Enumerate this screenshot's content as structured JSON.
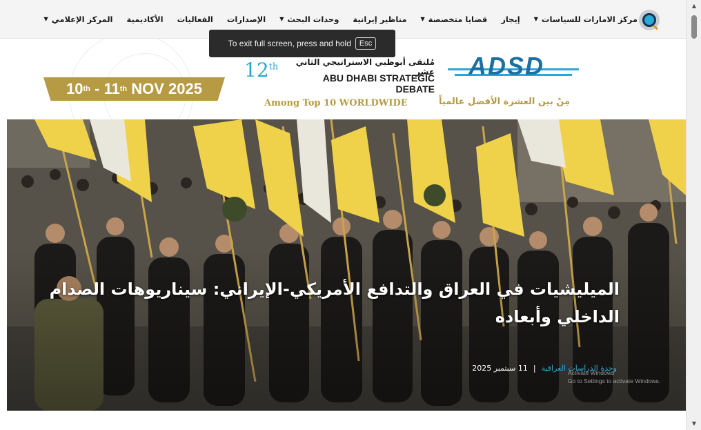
{
  "nav": {
    "logo_icon": "site-logo-icon",
    "items": [
      {
        "label": "مركز الامارات للسياسات",
        "dropdown": true
      },
      {
        "label": "إيجاز",
        "dropdown": false
      },
      {
        "label": "قضايا متخصصة",
        "dropdown": true
      },
      {
        "label": "مناظير إيرانية",
        "dropdown": false
      },
      {
        "label": "وحدات البحث",
        "dropdown": true
      },
      {
        "label": "الإصدارات",
        "dropdown": false
      },
      {
        "label": "الفعاليات",
        "dropdown": false
      },
      {
        "label": "الأكاديمية",
        "dropdown": false
      },
      {
        "label": "المركز الإعلامي",
        "dropdown": true
      }
    ]
  },
  "fullscreen_notice": {
    "text": "To exit full screen, press and hold",
    "key": "Esc"
  },
  "banner": {
    "dates_html": "10th - 11th NOV 2025",
    "dates": {
      "d1": "10",
      "s1": "th",
      "mid": " - 11",
      "s2": "th",
      "end": " NOV 2025"
    },
    "edition_num": "12",
    "edition_sup": "th",
    "title_ar": "مُلتقى أبوظبي الاستراتيجي الثاني عشر",
    "title_en": "ABU DHABI STRATEGIC DEBATE",
    "brand": "ADSD",
    "tagline_en": "Among Top 10 WORLDWIDE",
    "tagline_ar": "مِنْ بين العشرة الأفضل عالمياً"
  },
  "hero": {
    "title": "الميليشيات في العراق والتدافع الأمريكي-الإيراني: سيناريوهات الصدام الداخلي وأبعاده",
    "category": "وحدة الدراسات العراقية",
    "separator": "|",
    "date": "11 سبتمبر 2025",
    "watermark_line1": "Activate Windows",
    "watermark_line2": "Go to Settings to activate Windows."
  },
  "colors": {
    "accent_blue": "#28a7d5",
    "accent_gold": "#b79a44",
    "brand_navy": "#1e6fa0",
    "flag_yellow": "#f0d24a"
  }
}
